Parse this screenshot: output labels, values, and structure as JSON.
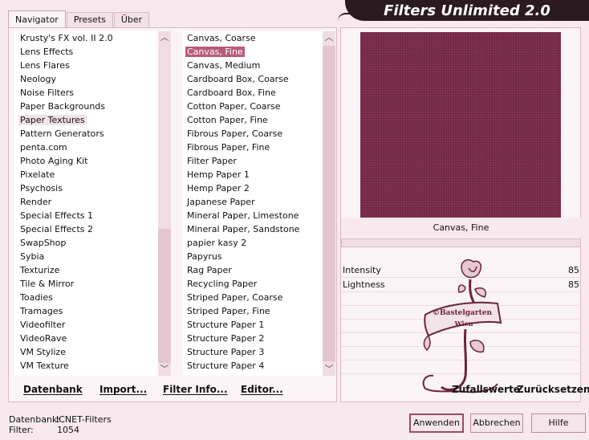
{
  "app": {
    "title": "Filters Unlimited 2.0"
  },
  "tabs": [
    {
      "label": "Navigator"
    },
    {
      "label": "Presets"
    },
    {
      "label": "Über"
    }
  ],
  "categories": {
    "items": [
      "Krusty's FX vol. II 2.0",
      "Lens Effects",
      "Lens Flares",
      "Neology",
      "Noise Filters",
      "Paper Backgrounds",
      "Paper Textures",
      "Pattern Generators",
      "penta.com",
      "Photo Aging Kit",
      "Pixelate",
      "Psychosis",
      "Render",
      "Special Effects 1",
      "Special Effects 2",
      "SwapShop",
      "Sybia",
      "Texturize",
      "Tile & Mirror",
      "Toadies",
      "Tramages",
      "Videofilter",
      "VideoRave",
      "VM Stylize",
      "VM Texture"
    ],
    "selected": "Paper Textures"
  },
  "filters": {
    "items": [
      "Canvas, Coarse",
      "Canvas, Fine",
      "Canvas, Medium",
      "Cardboard Box, Coarse",
      "Cardboard Box, Fine",
      "Cotton Paper, Coarse",
      "Cotton Paper, Fine",
      "Fibrous Paper, Coarse",
      "Fibrous Paper, Fine",
      "Filter Paper",
      "Hemp Paper 1",
      "Hemp Paper 2",
      "Japanese Paper",
      "Mineral Paper, Limestone",
      "Mineral Paper, Sandstone",
      "papier kasy 2",
      "Papyrus",
      "Rag Paper",
      "Recycling Paper",
      "Striped Paper, Coarse",
      "Striped Paper, Fine",
      "Structure Paper 1",
      "Structure Paper 2",
      "Structure Paper 3",
      "Structure Paper 4"
    ],
    "selected": "Canvas, Fine"
  },
  "toolbar": {
    "database": "Datenbank",
    "import": "Import...",
    "filter_info": "Filter Info...",
    "editor": "Editor..."
  },
  "preview": {
    "filter_name": "Canvas, Fine",
    "texture_color": "#7a2b4a"
  },
  "params": [
    {
      "label": "Intensity",
      "value": "85"
    },
    {
      "label": "Lightness",
      "value": "85"
    }
  ],
  "watermark": {
    "text_line1": "©Bastelgarten",
    "text_line2": "Wien"
  },
  "actions": {
    "random": "Zufallswerte",
    "reset": "Zurücksetzen"
  },
  "status": {
    "db_label": "Datenbank:",
    "db_value": "ICNET-Filters",
    "filter_label": "Filter:",
    "filter_value": "1054"
  },
  "dialog": {
    "apply": "Anwenden",
    "cancel": "Abbrechen",
    "help": "Hilfe"
  },
  "colors": {
    "accent": "#b85b78",
    "background": "#f7e9ee",
    "banner": "#2b1b20"
  }
}
